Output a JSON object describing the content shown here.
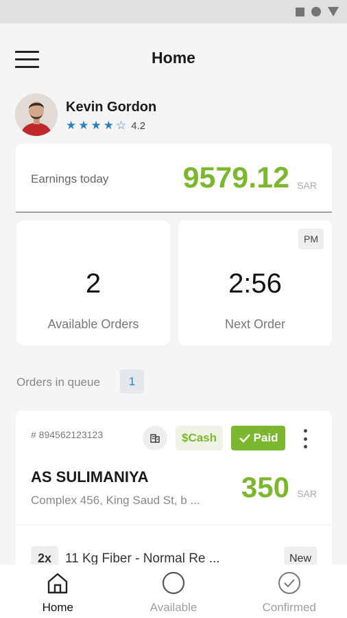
{
  "header": {
    "title": "Home"
  },
  "driver": {
    "name": "Kevin Gordon",
    "rating": 4.2,
    "rating_text": "4.2",
    "full_stars": 4,
    "empty_stars": 1
  },
  "earnings": {
    "label": "Earnings today",
    "value": "9579.12",
    "currency": "SAR"
  },
  "stats": {
    "available_orders": {
      "value": "2",
      "label": "Available Orders"
    },
    "next_order": {
      "value": "2:56",
      "period": "PM",
      "label": "Next Order"
    }
  },
  "queue": {
    "label": "Orders in queue",
    "count": "1"
  },
  "order": {
    "number": "# 894562123123",
    "payment_method": "Cash",
    "payment_symbol": "$",
    "status": "Paid",
    "customer": "AS SULIMANIYA",
    "address": "Complex 456, King Saud St, b ...",
    "amount": "350",
    "currency": "SAR",
    "item": {
      "qty": "2x",
      "name": "11 Kg Fiber - Normal Re ...",
      "tag": "New"
    }
  },
  "bottom_nav": [
    {
      "label": "Home",
      "icon": "home-icon",
      "active": true
    },
    {
      "label": "Available",
      "icon": "circle-icon",
      "active": false
    },
    {
      "label": "Confirmed",
      "icon": "check-circle-icon",
      "active": false
    }
  ],
  "colors": {
    "accent_green": "#7cb82f",
    "star_blue": "#2a7fc4",
    "background": "#f5f5f5"
  }
}
